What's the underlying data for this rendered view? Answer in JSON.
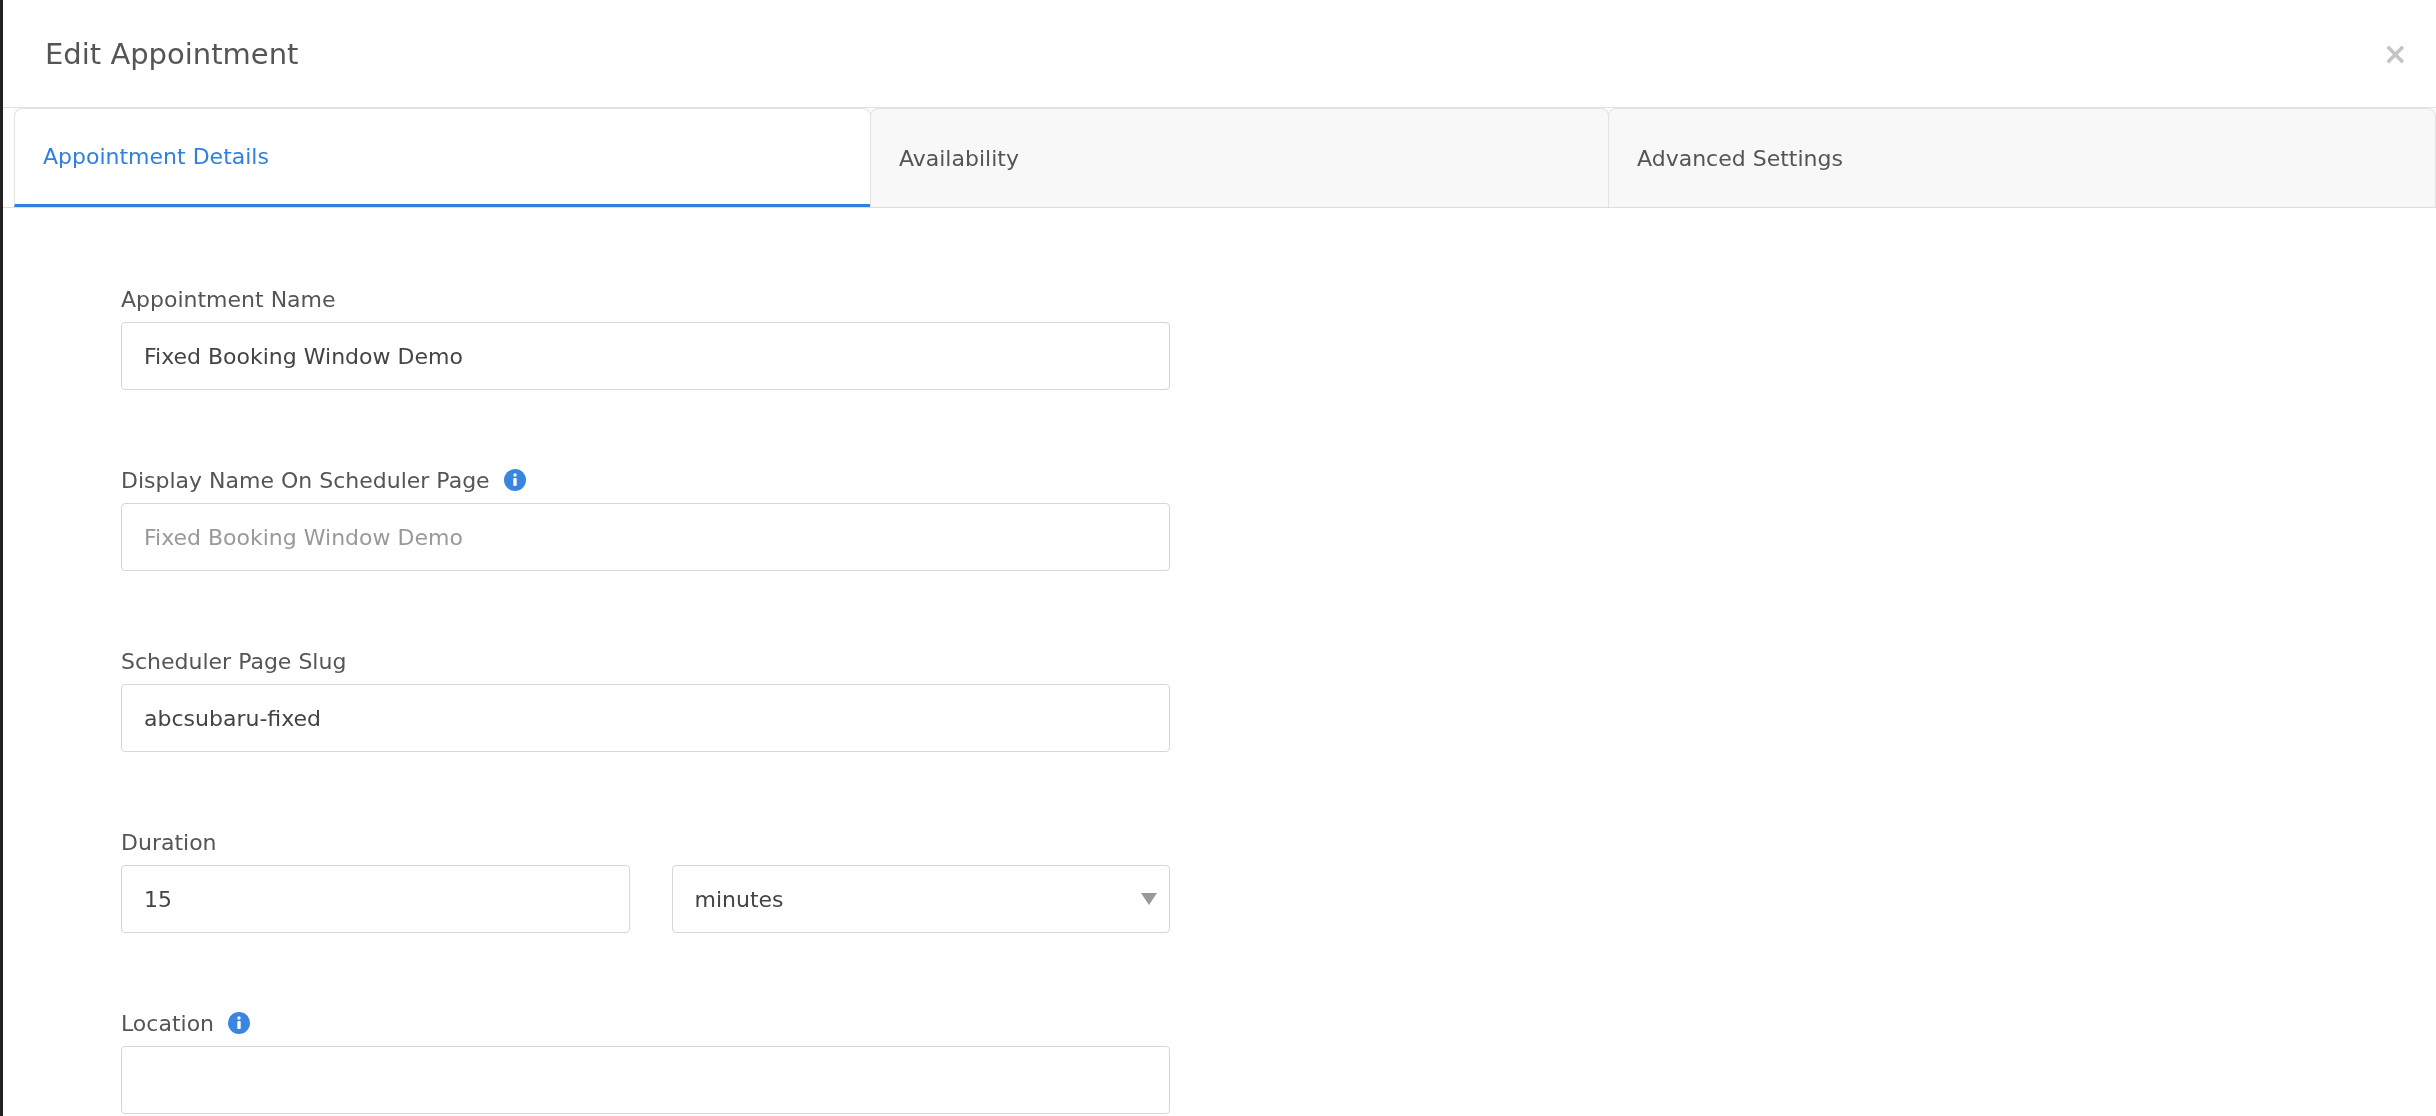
{
  "dialog": {
    "title": "Edit Appointment",
    "close": "×"
  },
  "tabs": [
    {
      "label": "Appointment Details",
      "selected": true
    },
    {
      "label": "Availability",
      "selected": false
    },
    {
      "label": "Advanced Settings",
      "selected": false
    }
  ],
  "fields": [
    {
      "kind": "text",
      "label": "Appointment Name",
      "info": false,
      "value": "Fixed Booking Window Demo"
    },
    {
      "kind": "text",
      "label": "Display Name On Scheduler Page",
      "info": true,
      "placeholder": "Fixed Booking Window Demo"
    },
    {
      "kind": "text",
      "label": "Scheduler Page Slug",
      "info": false,
      "value": "abcsubaru-fixed"
    },
    {
      "kind": "duration",
      "label": "Duration",
      "info": false,
      "value": "15",
      "unit": "minutes"
    },
    {
      "kind": "text",
      "label": "Location",
      "info": true
    }
  ]
}
